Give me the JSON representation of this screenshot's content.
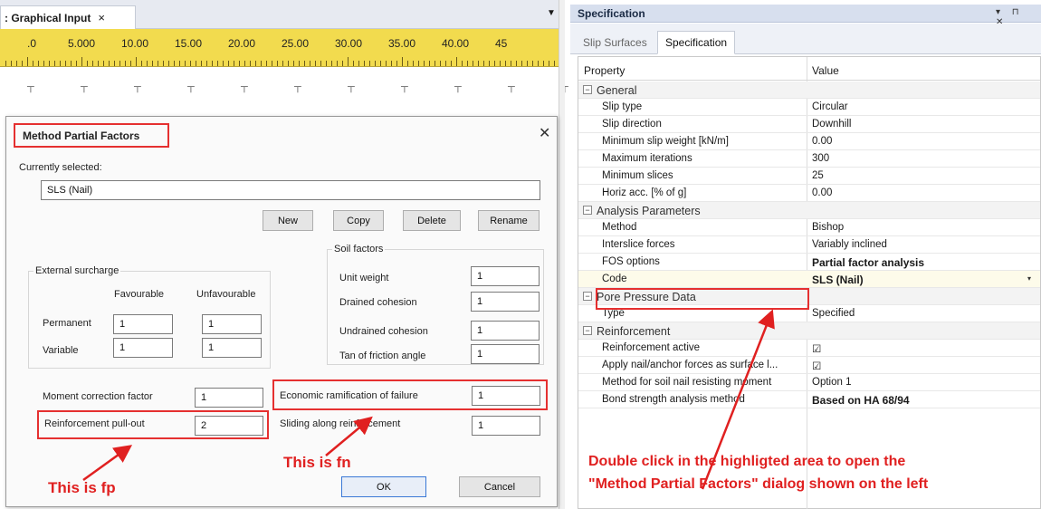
{
  "left_panel": {
    "tab_label": ": Graphical Input",
    "tab_close": "×",
    "dropdown_arrow": "▼",
    "ruler_labels": [
      ".0",
      "5.000",
      "10.00",
      "15.00",
      "20.00",
      "25.00",
      "30.00",
      "35.00",
      "40.00",
      "45"
    ],
    "canvas_mark": "┬"
  },
  "dialog": {
    "title": "Method Partial Factors",
    "close_symbol": "✕",
    "currently_selected_label": "Currently selected:",
    "currently_selected_value": "SLS (Nail)",
    "buttons": {
      "new": "New",
      "copy": "Copy",
      "delete": "Delete",
      "rename": "Rename",
      "ok": "OK",
      "cancel": "Cancel"
    },
    "external_surcharge": {
      "title": "External surcharge",
      "col_favourable": "Favourable",
      "col_unfavourable": "Unfavourable",
      "rows": [
        {
          "label": "Permanent",
          "favourable": "1",
          "unfavourable": "1"
        },
        {
          "label": "Variable",
          "favourable": "1",
          "unfavourable": "1"
        }
      ]
    },
    "soil_factors": {
      "title": "Soil factors",
      "rows": [
        {
          "label": "Unit weight",
          "value": "1"
        },
        {
          "label": "Drained cohesion",
          "value": "1"
        },
        {
          "label": "Undrained cohesion",
          "value": "1"
        },
        {
          "label": "Tan of friction angle",
          "value": "1"
        }
      ]
    },
    "moment_correction": {
      "label": "Moment correction factor",
      "value": "1"
    },
    "reinforcement_pullout": {
      "label": "Reinforcement pull-out",
      "value": "2"
    },
    "economic_ramification": {
      "label": "Economic ramification of failure",
      "value": "1"
    },
    "sliding_reinforcement": {
      "label": "Sliding along reinforcement",
      "value": "1"
    },
    "annotation_fp": "This is fp",
    "annotation_fn": "This is fn"
  },
  "spec_panel": {
    "title": "Specification",
    "window_buttons": "▾ ⊓ ✕",
    "tabs": [
      {
        "label": "Slip Surfaces",
        "active": false
      },
      {
        "label": "Specification",
        "active": true
      }
    ],
    "header_property": "Property",
    "header_value": "Value",
    "sections": {
      "general": "General",
      "analysis": "Analysis Parameters",
      "pore": "Pore Pressure Data",
      "reinforcement": "Reinforcement"
    },
    "expander": "⊟",
    "rows": {
      "slip_type": {
        "p": "Slip type",
        "v": "Circular"
      },
      "slip_direction": {
        "p": "Slip direction",
        "v": "Downhill"
      },
      "min_slip_weight": {
        "p": "Minimum slip weight [kN/m]",
        "v": "0.00"
      },
      "max_iterations": {
        "p": "Maximum iterations",
        "v": "300"
      },
      "min_slices": {
        "p": "Minimum slices",
        "v": "25"
      },
      "horiz_acc": {
        "p": "Horiz acc. [% of g]",
        "v": "0.00"
      },
      "method": {
        "p": "Method",
        "v": "Bishop"
      },
      "interslice": {
        "p": "Interslice forces",
        "v": "Variably inclined"
      },
      "fos_options": {
        "p": "FOS options",
        "v": "Partial factor analysis"
      },
      "code": {
        "p": "Code",
        "v": "SLS (Nail)"
      },
      "type": {
        "p": "Type",
        "v": "Specified"
      },
      "reinf_active": {
        "p": "Reinforcement active",
        "v": "☑"
      },
      "apply_nail": {
        "p": "Apply nail/anchor forces as surface l...",
        "v": "☑"
      },
      "method_soil_nail": {
        "p": "Method for soil nail resisting moment",
        "v": "Option 1"
      },
      "bond_strength": {
        "p": "Bond strength analysis method",
        "v": "Based on HA 68/94"
      }
    },
    "code_dropdown": "▾",
    "instruction_line1": "Double click in the highligted area to open the",
    "instruction_line2": "\"Method Partial Factors\" dialog shown on the left"
  },
  "colors": {
    "annotation_red": "#e02020",
    "ruler_yellow": "#f2db4e"
  }
}
